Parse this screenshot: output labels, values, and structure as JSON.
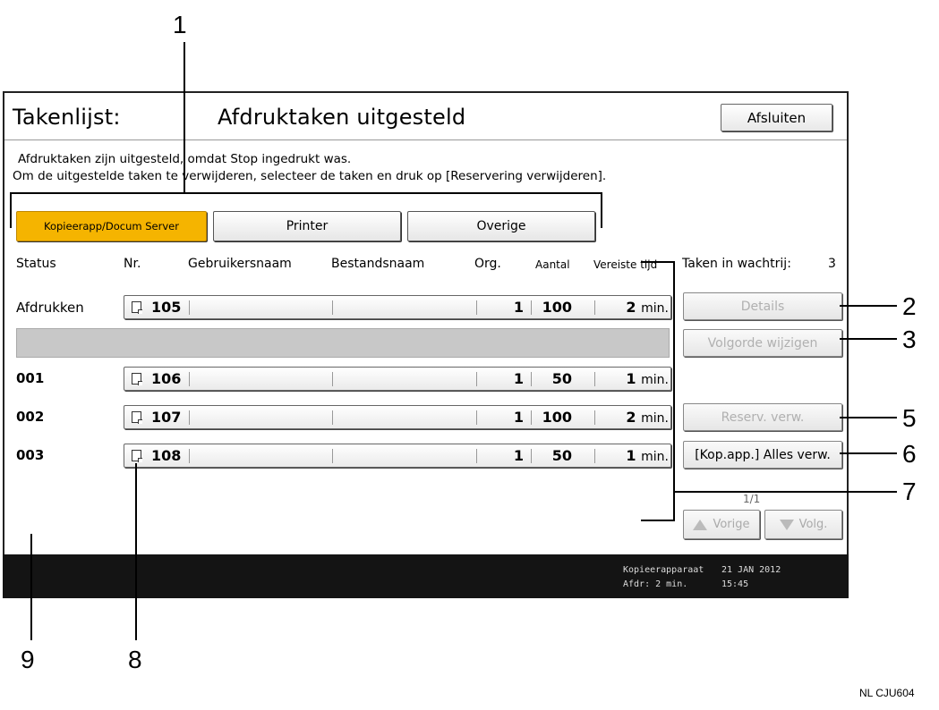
{
  "header": {
    "title_left": "Takenlijst:",
    "title_main": "Afdruktaken uitgesteld",
    "close_label": "Afsluiten"
  },
  "message": {
    "line1": "Afdruktaken zijn uitgesteld, omdat Stop ingedrukt was.",
    "line2": "Om de uitgestelde taken te verwijderen, selecteer de taken en druk op [Reservering verwijderen]."
  },
  "tabs": [
    {
      "label": "Kopieerapp/Docum Server",
      "active": true
    },
    {
      "label": "Printer",
      "active": false
    },
    {
      "label": "Overige",
      "active": false
    }
  ],
  "columns": {
    "status": "Status",
    "nr": "Nr.",
    "user": "Gebruikersnaam",
    "file": "Bestandsnaam",
    "org": "Org.",
    "qty": "Aantal",
    "time": "Vereiste tijd",
    "queue_label": "Taken in wachtrij:",
    "queue_count": "3"
  },
  "rows": [
    {
      "status": "Afdrukken",
      "nr": "105",
      "org": "1",
      "qty": "100",
      "time": "2",
      "unit": "min."
    },
    {
      "status": "001",
      "nr": "106",
      "org": "1",
      "qty": "50",
      "time": "1",
      "unit": "min."
    },
    {
      "status": "002",
      "nr": "107",
      "org": "1",
      "qty": "100",
      "time": "2",
      "unit": "min."
    },
    {
      "status": "003",
      "nr": "108",
      "org": "1",
      "qty": "50",
      "time": "1",
      "unit": "min."
    }
  ],
  "side_buttons": {
    "details": "Details",
    "reorder": "Volgorde wijzigen",
    "delete_reservation": "Reserv. verw.",
    "delete_all": "[Kop.app.] Alles verw."
  },
  "pagination": {
    "page": "1/1",
    "prev": "Vorige",
    "next": "Volg."
  },
  "statusbar": {
    "device": "Kopieerapparaat",
    "print_time": "Afdr: 2 min.",
    "date": "21 JAN  2012",
    "time": "15:45"
  },
  "callouts": [
    "1",
    "2",
    "3",
    "5",
    "6",
    "7",
    "8",
    "9"
  ],
  "figure_code": "NL CJU604"
}
